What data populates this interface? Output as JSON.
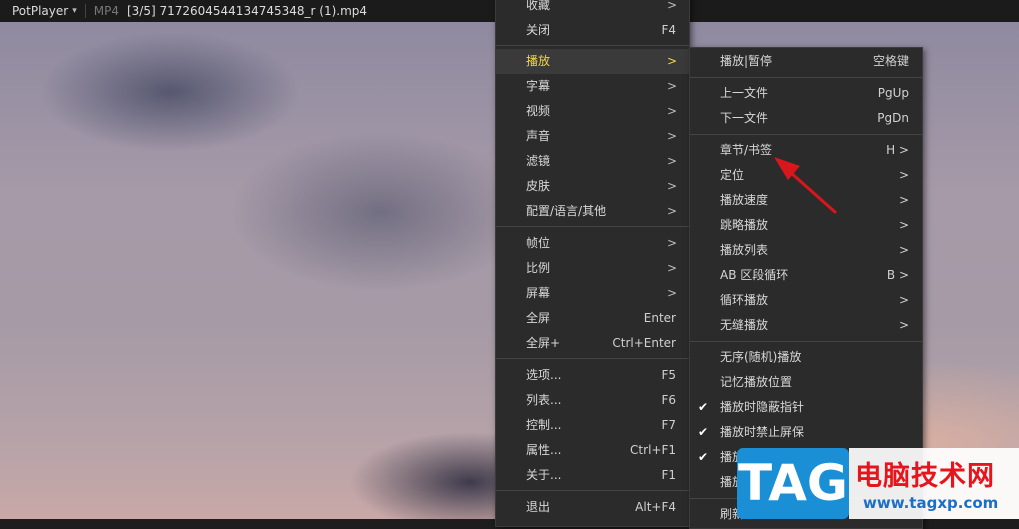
{
  "titlebar": {
    "app_name": "PotPlayer",
    "format": "MP4",
    "filename": "[3/5] 7172604544134745348_r (1).mp4"
  },
  "main_menu": {
    "items": [
      {
        "label": "收藏",
        "submenu": true
      },
      {
        "label": "关闭",
        "shortcut": "F4"
      },
      {
        "label": "播放",
        "submenu": true,
        "highlighted": true
      },
      {
        "label": "字幕",
        "submenu": true
      },
      {
        "label": "视频",
        "submenu": true
      },
      {
        "label": "声音",
        "submenu": true
      },
      {
        "label": "滤镜",
        "submenu": true
      },
      {
        "label": "皮肤",
        "submenu": true
      },
      {
        "label": "配置/语言/其他",
        "submenu": true
      },
      {
        "label": "帧位",
        "submenu": true
      },
      {
        "label": "比例",
        "submenu": true
      },
      {
        "label": "屏幕",
        "submenu": true
      },
      {
        "label": "全屏",
        "shortcut": "Enter"
      },
      {
        "label": "全屏+",
        "shortcut": "Ctrl+Enter"
      },
      {
        "label": "选项...",
        "shortcut": "F5"
      },
      {
        "label": "列表...",
        "shortcut": "F6"
      },
      {
        "label": "控制...",
        "shortcut": "F7"
      },
      {
        "label": "属性...",
        "shortcut": "Ctrl+F1"
      },
      {
        "label": "关于...",
        "shortcut": "F1"
      },
      {
        "label": "退出",
        "shortcut": "Alt+F4"
      }
    ],
    "arrow": ">"
  },
  "play_submenu": {
    "items": [
      {
        "label": "播放|暂停",
        "shortcut": "空格键"
      },
      {
        "label": "上一文件",
        "shortcut": "PgUp"
      },
      {
        "label": "下一文件",
        "shortcut": "PgDn"
      },
      {
        "label": "章节/书签",
        "shortcut": "H >"
      },
      {
        "label": "定位",
        "shortcut": ">"
      },
      {
        "label": "播放速度",
        "shortcut": ">"
      },
      {
        "label": "跳略播放",
        "shortcut": ">"
      },
      {
        "label": "播放列表",
        "shortcut": ">"
      },
      {
        "label": "AB 区段循环",
        "shortcut": "B >"
      },
      {
        "label": "循环播放",
        "shortcut": ">"
      },
      {
        "label": "无缝播放",
        "shortcut": ">"
      },
      {
        "label": "无序(随机)播放"
      },
      {
        "label": "记忆播放位置"
      },
      {
        "label": "播放时隐蔽指针",
        "checked": true
      },
      {
        "label": "播放时禁止屏保",
        "checked": true
      },
      {
        "label": "播放",
        "checked": true
      },
      {
        "label": "播放"
      },
      {
        "label": "刷新"
      }
    ],
    "check": "✔"
  },
  "watermark": {
    "tag": "TAG",
    "title": "电脑技术网",
    "url": "www.tagxp.com"
  },
  "colors": {
    "highlight_text": "#f2d54a",
    "menu_bg": "#2b2b2b",
    "annotation_arrow": "#d9161c",
    "watermark_blue": "#1a8fd6",
    "watermark_red": "#e8141c"
  }
}
